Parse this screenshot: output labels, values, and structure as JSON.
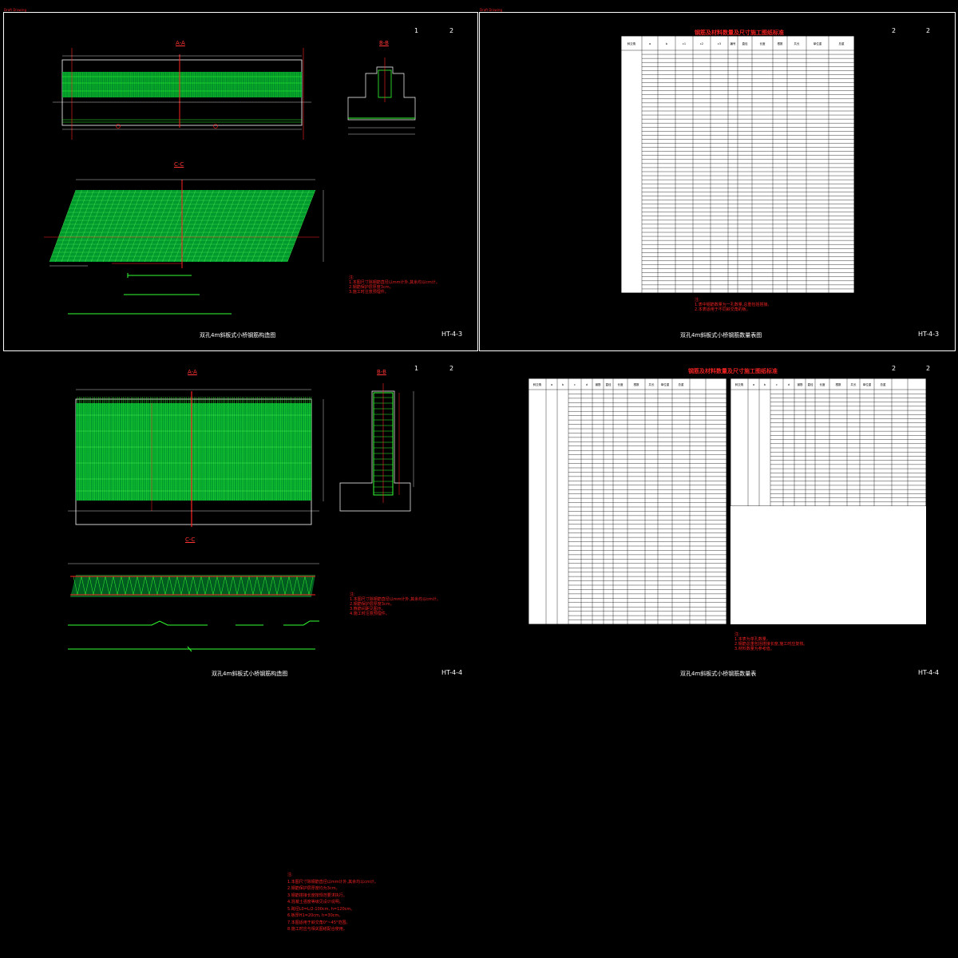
{
  "sheets": [
    {
      "page_a": "1",
      "page_b": "2",
      "code": "HT-4-3",
      "title": "双孔4m斜板式小桥钢筋构造图",
      "section_aa": "A-A",
      "section_bb": "B-B",
      "section_cc": "C-C"
    },
    {
      "page_a": "2",
      "page_b": "2",
      "code": "HT-4-3",
      "title": "双孔4m斜板式小桥钢筋数量表图",
      "table_title": "钢筋及材料数量及尺寸施工图纸标准"
    },
    {
      "page_a": "1",
      "page_b": "2",
      "code": "HT-4-4",
      "title": "双孔4m斜板式小桥钢筋构造图",
      "section_aa": "A-A",
      "section_bb": "B-B",
      "section_cc": "C-C"
    },
    {
      "page_a": "2",
      "page_b": "2",
      "code": "HT-4-4",
      "title": "双孔4m斜板式小桥钢筋数量表",
      "table_title": "钢筋及材料数量及尺寸施工图纸标准"
    }
  ],
  "corner_tag": "Draft Drawing",
  "table1": {
    "headers": [
      "斜交角\n(度)",
      "α\n(cm)",
      "b\n(cm)",
      "c1\n(cm)",
      "c2\n(cm)",
      "c3\n(cm)",
      "编号",
      "直径",
      "长度",
      "根数",
      "共长",
      "单位重",
      "总重"
    ],
    "row_count": 60
  },
  "table2": {
    "headers": [
      "斜交角\n(度)",
      "α",
      "b",
      "c",
      "d",
      "钢筋\n编号",
      "直径",
      "长度",
      "根数",
      "共长",
      "单位重",
      "总重"
    ],
    "row_count": 54
  },
  "bottom_notes": [
    "注:",
    "1.本图尺寸除钢筋直径以mm计外,其余均以cm计。",
    "2.钢筋保护层厚度均为3cm。",
    "3.钢筋搭接长度按规范要求执行。",
    "4.混凝土强度等级见设计说明。",
    "5.跨径L0=L/2-100cm, h=120cm。",
    "6.板厚H1=20cm, h=30cm。",
    "7.本图适用于斜交角0°~45°范围。",
    "8.施工时应与相关图纸配合使用。"
  ],
  "sheet_notes": {
    "s1": [
      "注:",
      "1.本图尺寸除钢筋直径以mm计外,其余均以cm计。",
      "2.钢筋保护层厚度3cm。",
      "3.施工时注意预埋件。"
    ],
    "s2": [
      "注:",
      "1.表中钢筋数量为一孔数量,总重包括搭接。",
      "2.本表适用于不同斜交角的板。"
    ],
    "s3": [
      "注:",
      "1.本图尺寸除钢筋直径以mm计外,其余均以cm计。",
      "2.钢筋保护层厚度3cm。",
      "3.箍筋间距见图示。",
      "4.施工时注意预埋件。"
    ],
    "s4": [
      "注:",
      "1.本表为单孔数量。",
      "2.钢筋总重包括搭接长度,施工时应复核。",
      "3.材料数量为参考值。"
    ]
  }
}
